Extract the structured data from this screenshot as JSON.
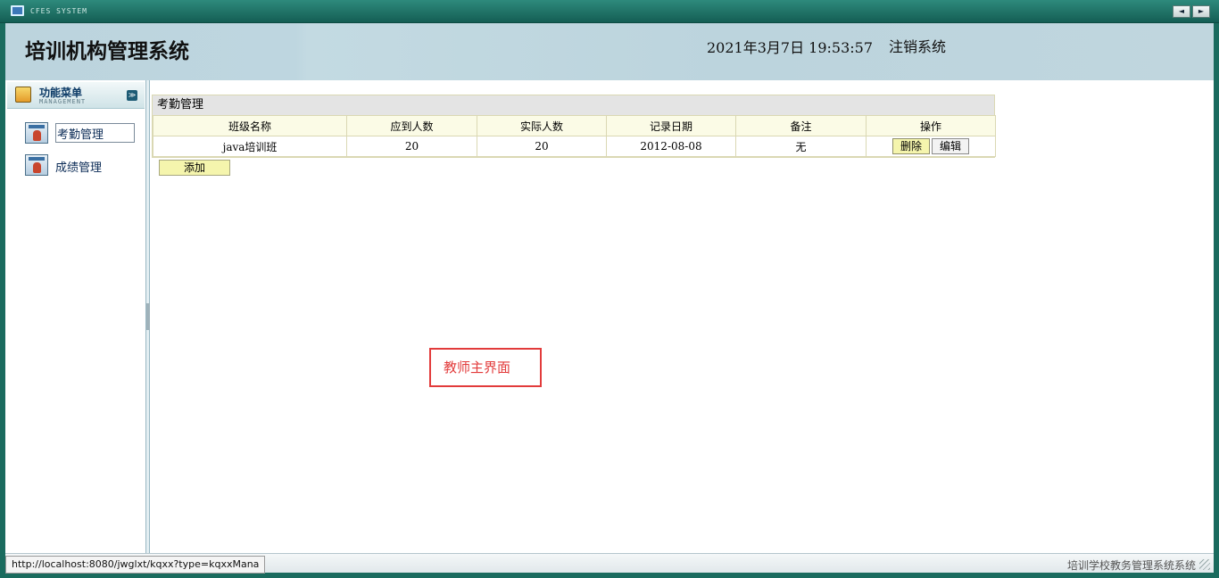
{
  "window": {
    "system_label": "CFES SYSTEM",
    "prev_label": "◄",
    "next_label": "►"
  },
  "header": {
    "title": "培训机构管理系统",
    "datetime": "2021年3月7日 19:53:57",
    "logout_label": "注销系统"
  },
  "sidebar": {
    "menu_title": "功能菜单",
    "menu_subtitle": "MANAGEMENT",
    "toggle_label": "≫",
    "items": [
      {
        "label": "考勤管理",
        "active": true
      },
      {
        "label": "成绩管理",
        "active": false
      }
    ]
  },
  "panel": {
    "title": "考勤管理",
    "columns": [
      "班级名称",
      "应到人数",
      "实际人数",
      "记录日期",
      "备注",
      "操作"
    ],
    "rows": [
      {
        "class_name": "java培训班",
        "expected": "20",
        "actual": "20",
        "date": "2012-08-08",
        "note": "无"
      }
    ],
    "delete_label": "删除",
    "edit_label": "编辑",
    "add_label": "添加"
  },
  "annotation": {
    "text": "教师主界面",
    "color": "#e23b3b"
  },
  "statusbar": {
    "url": "http://localhost:8080/jwglxt/kqxx?type=kqxxMana",
    "right_text": "培训学校教务管理系统系统"
  },
  "colors": {
    "frame_green": "#1a6b5e",
    "header_blue": "#bcd4dd",
    "button_yellow": "#f5f5ad",
    "table_header": "#fbfbe6"
  }
}
